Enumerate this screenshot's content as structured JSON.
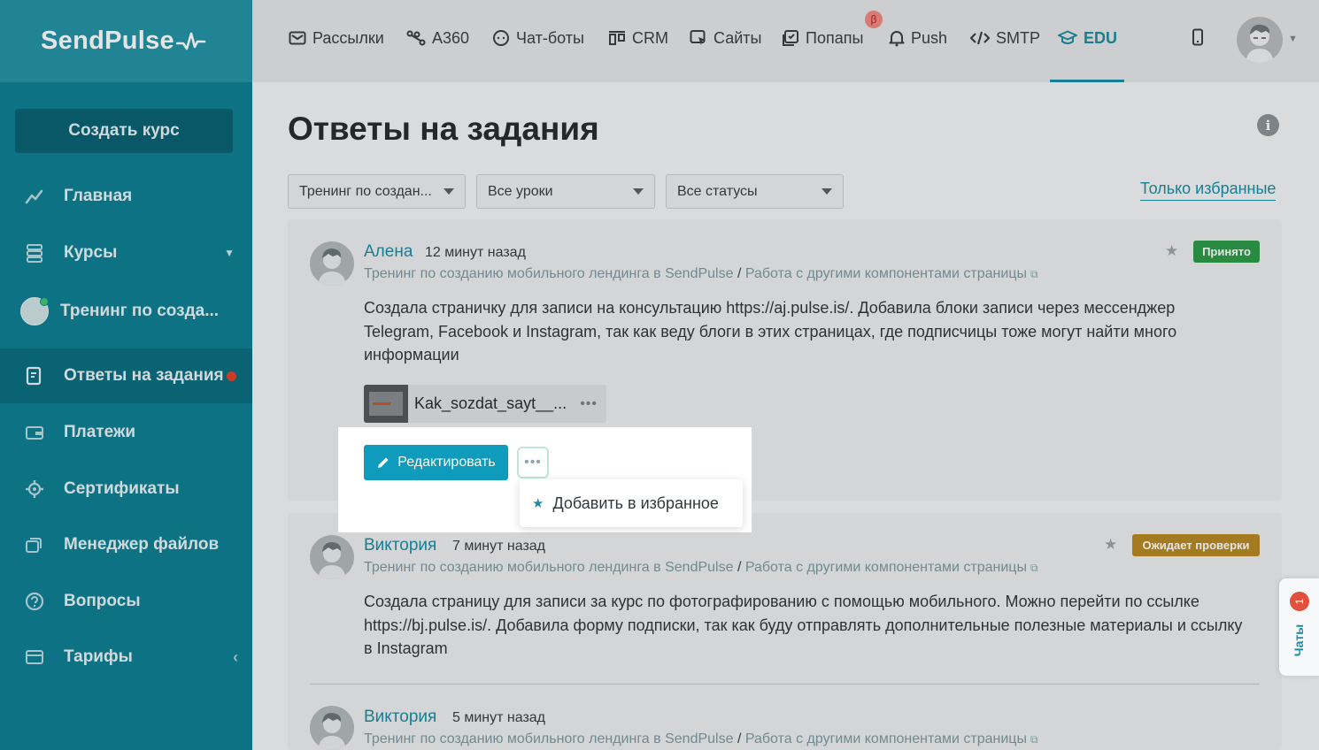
{
  "app": {
    "logo": "SendPulse"
  },
  "sidebar": {
    "create_button": "Создать курс",
    "items": [
      {
        "label": "Главная"
      },
      {
        "label": "Курсы"
      },
      {
        "label": "Тренинг по созда..."
      },
      {
        "label": "Ответы на задания"
      },
      {
        "label": "Платежи"
      },
      {
        "label": "Сертификаты"
      },
      {
        "label": "Менеджер файлов"
      },
      {
        "label": "Вопросы"
      },
      {
        "label": "Тарифы"
      }
    ]
  },
  "topnav": {
    "items": [
      {
        "label": "Рассылки"
      },
      {
        "label": "A360"
      },
      {
        "label": "Чат-боты"
      },
      {
        "label": "CRM"
      },
      {
        "label": "Сайты"
      },
      {
        "label": "Попапы"
      },
      {
        "label": "Push"
      },
      {
        "label": "SMTP"
      },
      {
        "label": "EDU"
      }
    ],
    "beta_label": "β",
    "active": "EDU"
  },
  "page": {
    "title": "Ответы на задания",
    "info_icon_label": "i"
  },
  "filters": {
    "course": "Тренинг по создан...",
    "lessons": "Все уроки",
    "statuses": "Все статусы",
    "favorites_link": "Только избранные"
  },
  "answers": [
    {
      "author": "Алена",
      "time": "12 минут назад",
      "course": "Тренинг по созданию мобильного лендинга в SendPulse",
      "separator": "/",
      "lesson": "Работа с другими компонентами страницы",
      "text": "Создала страничку для записи на консультацию https://aj.pulse.is/. Добавила блоки записи через мессенджер Telegram, Facebook и Instagram, так как веду блоги в этих страницах, где подписчицы тоже могут найти много информации",
      "status": "Принято",
      "status_color": "#2e9a4a",
      "attachment": "Kak_sozdat_sayt__..."
    },
    {
      "author": "Виктория",
      "time": "7 минут назад",
      "course": "Тренинг по созданию мобильного лендинга в SendPulse",
      "separator": "/",
      "lesson": "Работа с другими компонентами страницы",
      "text": "Создала страницу для записи за курс по фотографированию с помощью мобильного. Можно перейти по ссылке https://bj.pulse.is/. Добавила форму подписки, так как буду отправлять дополнительные полезные материалы и ссылку в Instagram",
      "status": "Ожидает проверки",
      "status_color": "#b88a25"
    },
    {
      "author": "Виктория",
      "time": "5 минут назад",
      "course": "Тренинг по созданию мобильного лендинга в SendPulse",
      "separator": "/",
      "lesson": "Работа с другими компонентами страницы"
    }
  ],
  "actions": {
    "edit_button": "Редактировать",
    "more_dots": "•••",
    "dropdown_item": "Добавить в избранное"
  },
  "chats": {
    "label": "Чаты",
    "count": "1"
  },
  "colors": {
    "accent": "#1b8da3",
    "sidebar": "#0f7f93",
    "primary_button": "#0f9bbb"
  }
}
